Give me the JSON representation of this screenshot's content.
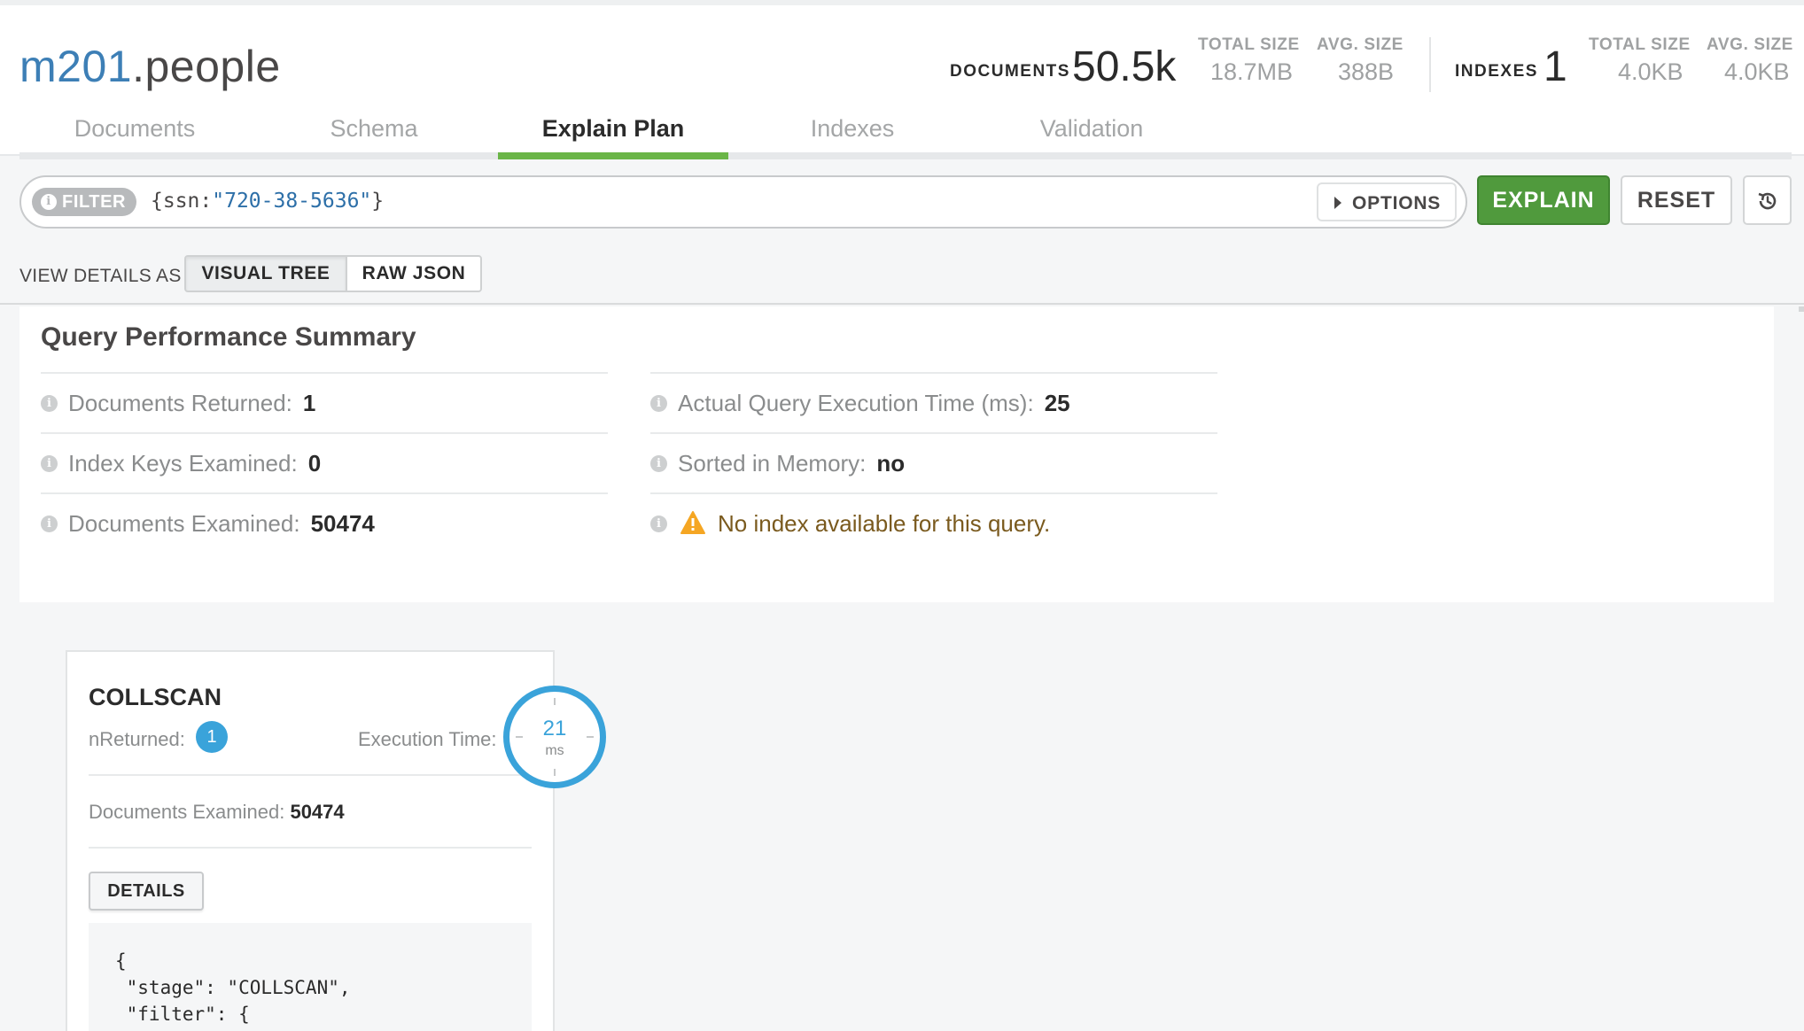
{
  "namespace": {
    "database": "m201",
    "separator": ".",
    "collection": "people"
  },
  "stats": {
    "documents": {
      "label": "DOCUMENTS",
      "count": "50.5k",
      "total_size_label": "TOTAL SIZE",
      "total_size": "18.7MB",
      "avg_size_label": "AVG. SIZE",
      "avg_size": "388B"
    },
    "indexes": {
      "label": "INDEXES",
      "count": "1",
      "total_size_label": "TOTAL SIZE",
      "total_size": "4.0KB",
      "avg_size_label": "AVG. SIZE",
      "avg_size": "4.0KB"
    }
  },
  "tabs": [
    {
      "label": "Documents"
    },
    {
      "label": "Schema"
    },
    {
      "label": "Explain Plan"
    },
    {
      "label": "Indexes"
    },
    {
      "label": "Validation"
    }
  ],
  "active_tab": "Explain Plan",
  "filter": {
    "label": "FILTER",
    "query_prefix": "{ssn:",
    "query_value": "\"720-38-5636\"",
    "query_suffix": "}",
    "options_label": "OPTIONS"
  },
  "actions": {
    "explain": "EXPLAIN",
    "reset": "RESET",
    "history_icon": "history-icon"
  },
  "view_details": {
    "label": "VIEW DETAILS AS",
    "visual_tree": "VISUAL TREE",
    "raw_json": "RAW JSON",
    "selected": "VISUAL TREE"
  },
  "summary": {
    "title": "Query Performance Summary",
    "docs_returned": {
      "label": "Documents Returned:",
      "value": "1"
    },
    "index_keys_examined": {
      "label": "Index Keys Examined:",
      "value": "0"
    },
    "docs_examined": {
      "label": "Documents Examined:",
      "value": "50474"
    },
    "exec_time": {
      "label": "Actual Query Execution Time (ms):",
      "value": "25"
    },
    "sorted_in_memory": {
      "label": "Sorted in Memory:",
      "value": "no"
    },
    "warning": "No index available for this query."
  },
  "stage": {
    "name": "COLLSCAN",
    "n_returned_label": "nReturned:",
    "n_returned": "1",
    "exec_time_label": "Execution Time:",
    "exec_time": "21",
    "exec_unit": "ms",
    "docs_examined_label": "Documents Examined:",
    "docs_examined": "50474",
    "details_label": "DETAILS",
    "json_lines": [
      "{",
      " \"stage\": \"COLLSCAN\",",
      " \"filter\": {"
    ]
  },
  "colors": {
    "accent_green": "#509a3d",
    "tab_underline": "#6ab547",
    "namespace_db": "#3d7fb6",
    "badge_blue": "#3aa3da",
    "warning_orange": "#f5a623"
  }
}
